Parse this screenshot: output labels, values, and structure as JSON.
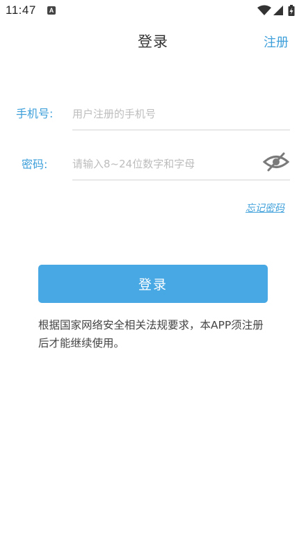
{
  "status_bar": {
    "time": "11:47",
    "notification_letter": "A",
    "icons": [
      "wifi-icon",
      "signal-icon",
      "battery-charging-icon"
    ]
  },
  "header": {
    "title": "登录",
    "register_label": "注册"
  },
  "form": {
    "phone_label": "手机号:",
    "phone_placeholder": "用户注册的手机号",
    "password_label": "密码:",
    "password_placeholder": "请输入8~24位数字和字母",
    "password_toggle_icon": "eye-off-icon",
    "forgot_label": "忘记密码"
  },
  "login_button_label": "登录",
  "notice_text": "根据国家网络安全相关法规要求，本APP须注册后才能继续使用。",
  "colors": {
    "accent": "#3d9fda",
    "button": "#48a8e3",
    "divider": "#e8e8e8"
  }
}
